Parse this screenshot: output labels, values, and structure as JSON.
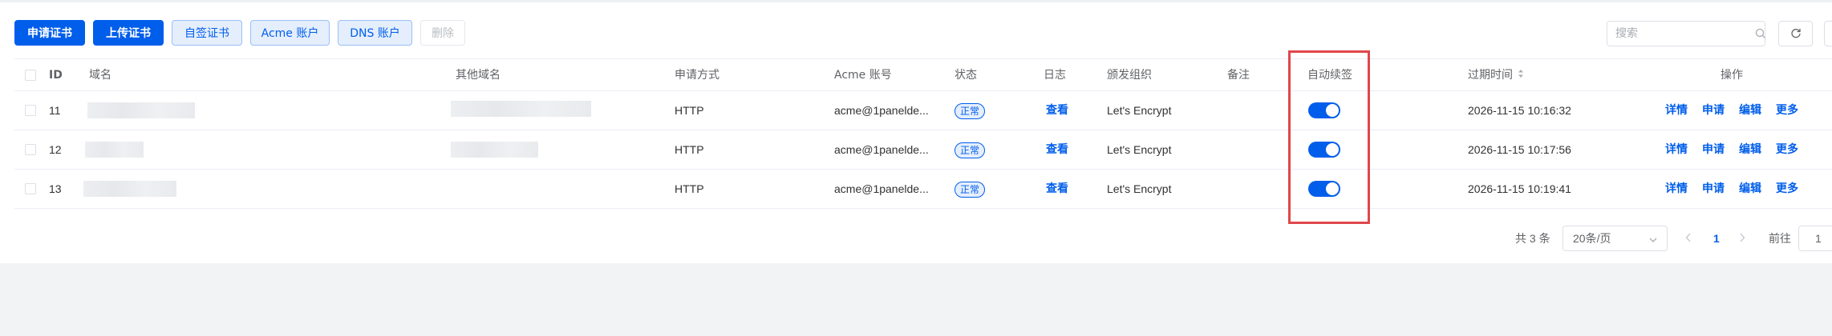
{
  "toolbar": {
    "apply_cert": "申请证书",
    "upload_cert": "上传证书",
    "self_signed": "自签证书",
    "acme_account": "Acme 账户",
    "dns_account": "DNS 账户",
    "delete": "删除"
  },
  "search": {
    "placeholder": "搜索",
    "value": ""
  },
  "table": {
    "headers": {
      "id": "ID",
      "domain": "域名",
      "other_domains": "其他域名",
      "apply_method": "申请方式",
      "acme_account": "Acme 账号",
      "status": "状态",
      "log": "日志",
      "issuer": "颁发组织",
      "remark": "备注",
      "auto_renew": "自动续签",
      "expire_time": "过期时间",
      "actions": "操作"
    },
    "rows": [
      {
        "id": "11",
        "apply_method": "HTTP",
        "acme_account": "acme@1panelde...",
        "status": "正常",
        "log": "查看",
        "issuer": "Let's Encrypt",
        "auto_renew": true,
        "expire_time": "2026-11-15 10:16:32"
      },
      {
        "id": "12",
        "apply_method": "HTTP",
        "acme_account": "acme@1panelde...",
        "status": "正常",
        "log": "查看",
        "issuer": "Let's Encrypt",
        "auto_renew": true,
        "expire_time": "2026-11-15 10:17:56"
      },
      {
        "id": "13",
        "apply_method": "HTTP",
        "acme_account": "acme@1panelde...",
        "status": "正常",
        "log": "查看",
        "issuer": "Let's Encrypt",
        "auto_renew": true,
        "expire_time": "2026-11-15 10:19:41"
      }
    ],
    "row_actions": {
      "detail": "详情",
      "apply": "申请",
      "edit": "编辑",
      "more": "更多"
    }
  },
  "pagination": {
    "total": "共 3 条",
    "page_size": "20条/页",
    "current_page": "1",
    "goto_label": "前往",
    "goto_value": "1"
  },
  "colors": {
    "primary": "#005eeb",
    "highlight": "#e0474b"
  }
}
